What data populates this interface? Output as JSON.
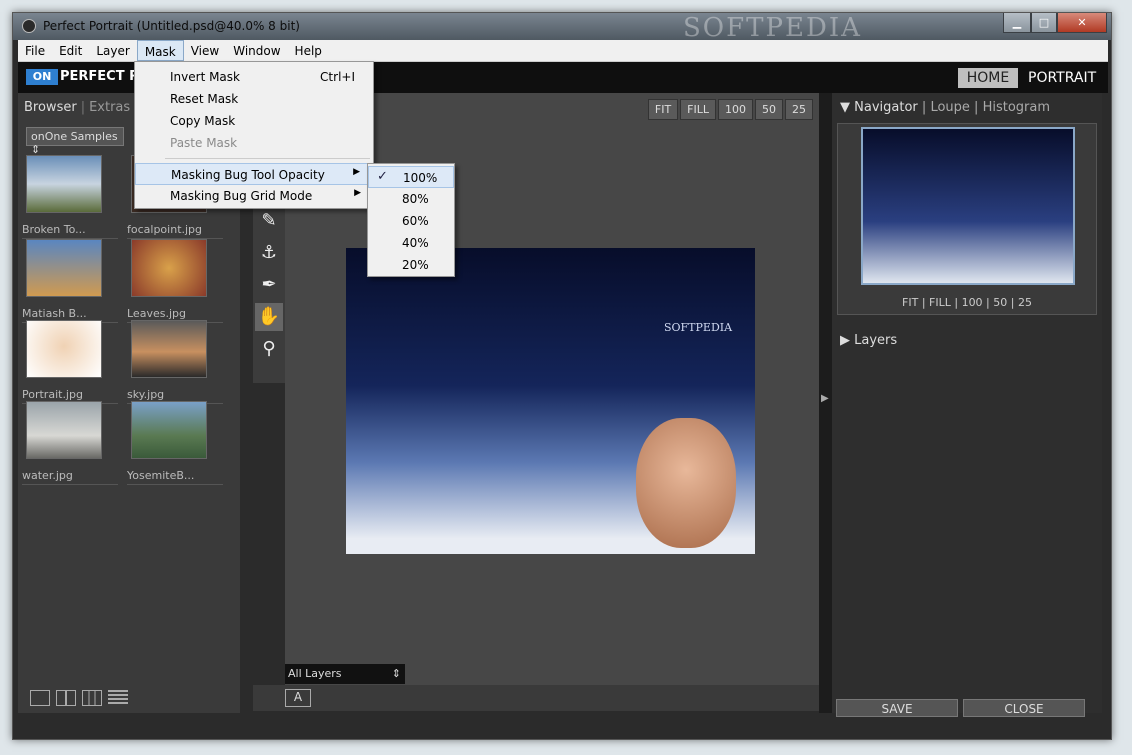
{
  "window": {
    "title": "Perfect Portrait (Untitled.psd@40.0% 8 bit)",
    "watermark": "SOFTPEDIA"
  },
  "menubar": [
    "File",
    "Edit",
    "Layer",
    "Mask",
    "View",
    "Window",
    "Help"
  ],
  "header": {
    "logo": "ON",
    "brand": "PERFECT P",
    "home": "HOME",
    "portrait": "PORTRAIT"
  },
  "left": {
    "tabs": {
      "browser": "Browser",
      "extras": "Extras"
    },
    "source_select": "onOne Samples",
    "thumbs": [
      {
        "caption": "Broken To...",
        "color": "#6a8fb8"
      },
      {
        "caption": "focalpoint.jpg",
        "color": "#6b4e3c"
      },
      {
        "caption": "Matiash B...",
        "color": "#c98a3e"
      },
      {
        "caption": "Leaves.jpg",
        "color": "#b8673a"
      },
      {
        "caption": "Portrait.jpg",
        "color": "#e3c6a8"
      },
      {
        "caption": "sky.jpg",
        "color": "#8a6f5a"
      },
      {
        "caption": "water.jpg",
        "color": "#b2b6b8"
      },
      {
        "caption": "YosemiteB...",
        "color": "#4f7a5e"
      }
    ]
  },
  "zoombar": [
    "FIT",
    "FILL",
    "100",
    "50",
    "25"
  ],
  "canvas": {
    "photo_text": "SOFTPEDIA",
    "layers_select": "All Layers",
    "a_button": "A"
  },
  "mask_menu": {
    "invert": "Invert Mask",
    "invert_shortcut": "Ctrl+I",
    "reset": "Reset Mask",
    "copy": "Copy Mask",
    "paste": "Paste Mask",
    "opacity": "Masking Bug Tool Opacity",
    "grid": "Masking Bug Grid Mode"
  },
  "opacity_submenu": [
    "100%",
    "80%",
    "60%",
    "40%",
    "20%"
  ],
  "right": {
    "nav_tabs": {
      "navigator": "Navigator",
      "loupe": "Loupe",
      "histogram": "Histogram"
    },
    "nav_zoom": "FIT | FILL | 100 | 50 | 25",
    "layers": "Layers",
    "save": "SAVE",
    "close": "CLOSE"
  }
}
